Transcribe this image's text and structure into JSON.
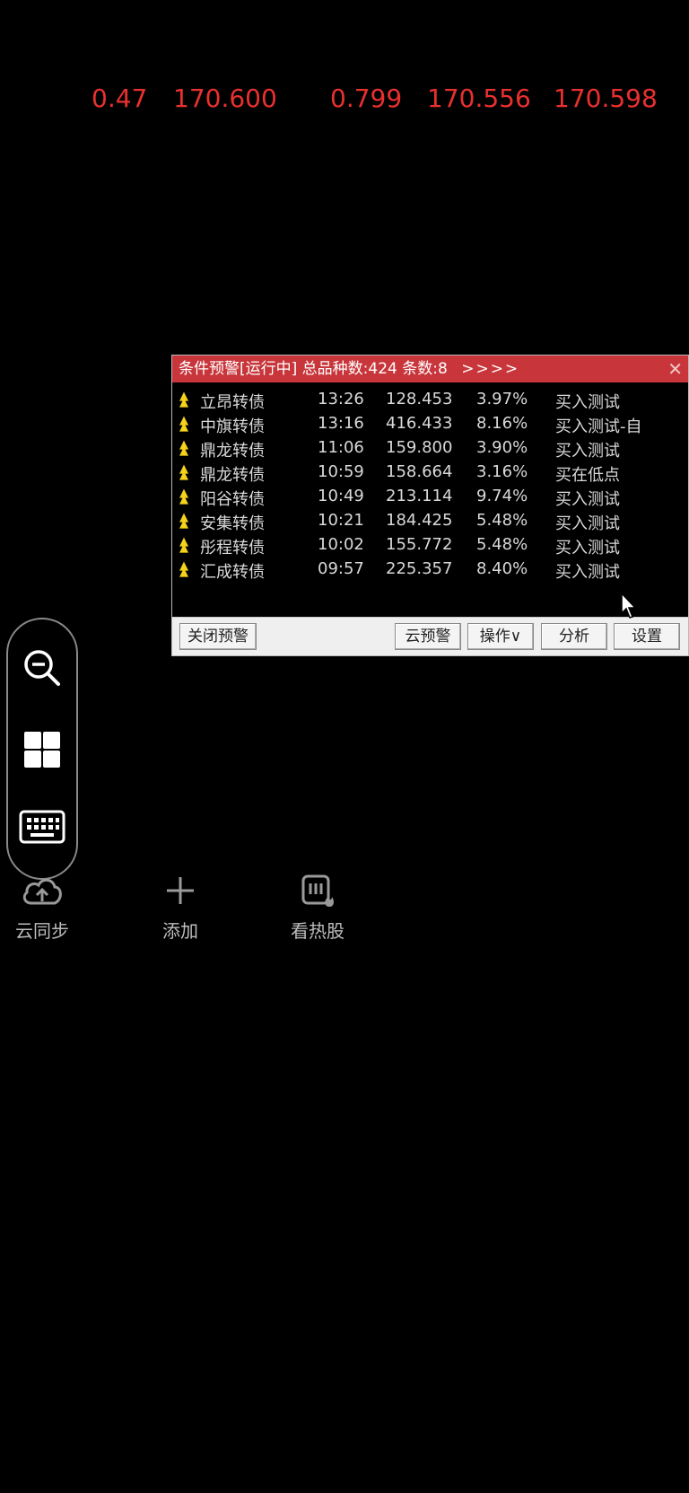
{
  "quotes": [
    "0.47",
    "170.600",
    "0.799",
    "170.556",
    "170.598"
  ],
  "alert": {
    "title": "条件预警[运行中] 总品种数:424 条数:8",
    "arrows": ">>>>",
    "close": "✕",
    "rows": [
      {
        "name": "立昂转债",
        "time": "13:26",
        "price": "128.453",
        "pct": "3.97%",
        "action": "买入测试"
      },
      {
        "name": "中旗转债",
        "time": "13:16",
        "price": "416.433",
        "pct": "8.16%",
        "action": "买入测试-自"
      },
      {
        "name": "鼎龙转债",
        "time": "11:06",
        "price": "159.800",
        "pct": "3.90%",
        "action": "买入测试"
      },
      {
        "name": "鼎龙转债",
        "time": "10:59",
        "price": "158.664",
        "pct": "3.16%",
        "action": "买在低点"
      },
      {
        "name": "阳谷转债",
        "time": "10:49",
        "price": "213.114",
        "pct": "9.74%",
        "action": "买入测试"
      },
      {
        "name": "安集转债",
        "time": "10:21",
        "price": "184.425",
        "pct": "5.48%",
        "action": "买入测试"
      },
      {
        "name": "彤程转债",
        "time": "10:02",
        "price": "155.772",
        "pct": "5.48%",
        "action": "买入测试"
      },
      {
        "name": "汇成转债",
        "time": "09:57",
        "price": "225.357",
        "pct": "8.40%",
        "action": "买入测试"
      }
    ],
    "buttons": {
      "close_alert": "关闭预警",
      "cloud_alert": "云预警",
      "operate": "操作∨",
      "analyze": "分析",
      "settings": "设置"
    }
  },
  "pill": {
    "icons": [
      "zoom-out-icon",
      "windows-icon",
      "keyboard-icon"
    ]
  },
  "tools": {
    "cloud_sync": "云同步",
    "add": "添加",
    "hot_stocks": "看热股"
  },
  "colors": {
    "quote_red": "#e8312e",
    "title_bar": "#c8363b",
    "up_arrow": "#f5d21c"
  }
}
